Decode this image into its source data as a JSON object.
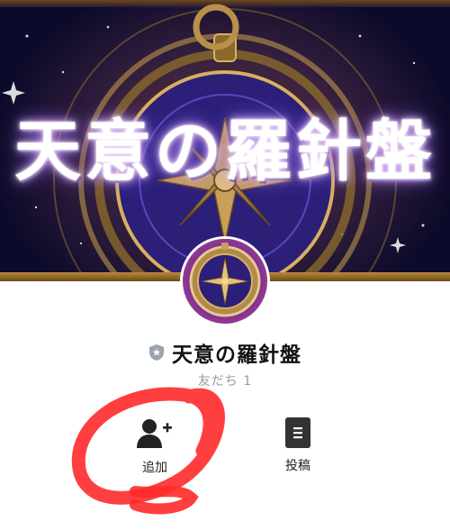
{
  "cover": {
    "title": "天意の羅針盤"
  },
  "profile": {
    "name": "天意の羅針盤",
    "friends": "友だち 1",
    "badge_icon": "shield-badge-icon"
  },
  "actions": [
    {
      "label": "追加",
      "icon": "add-friend-icon"
    },
    {
      "label": "投稿",
      "icon": "post-list-icon"
    }
  ],
  "annotation": {
    "color": "#ff2a2a"
  }
}
